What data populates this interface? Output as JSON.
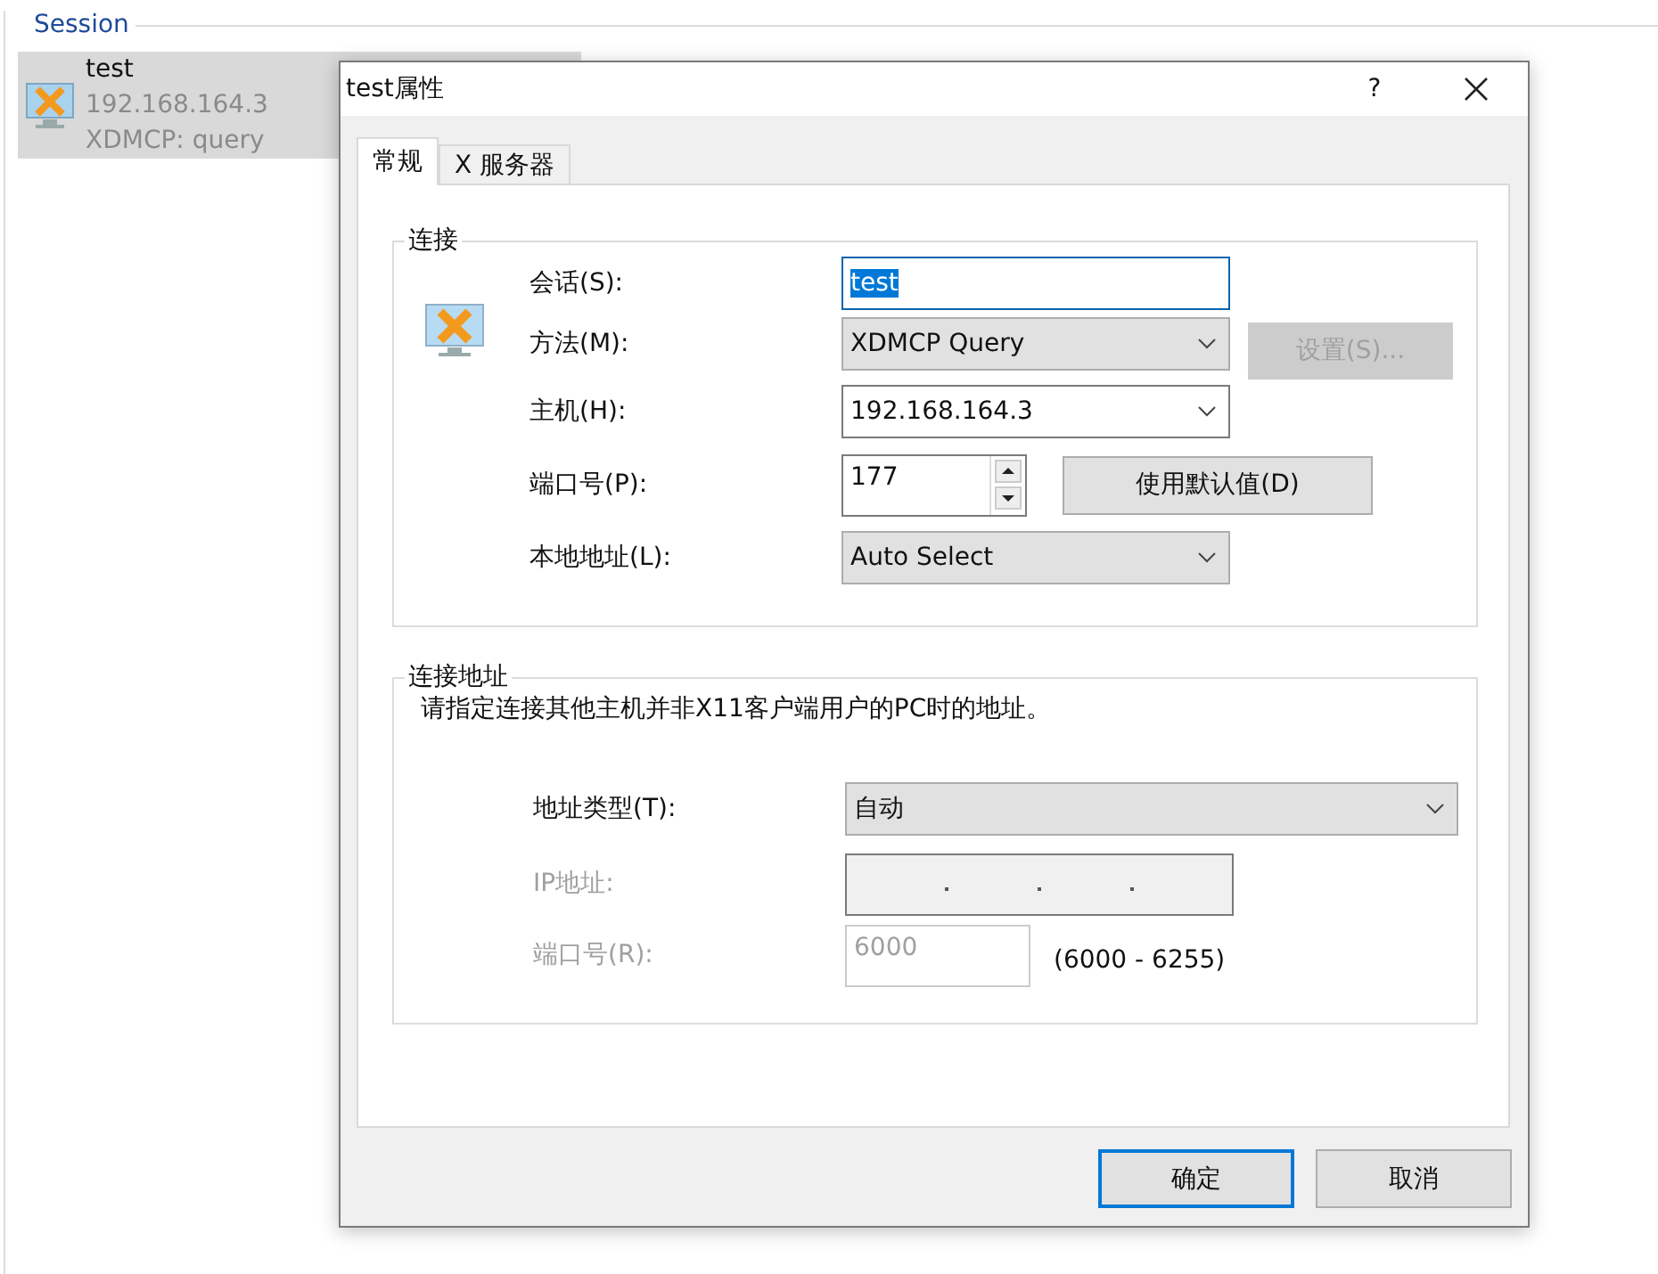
{
  "session_list": {
    "title": "Session",
    "items": [
      {
        "name": "test",
        "host": "192.168.164.3",
        "method": "XDMCP: query",
        "selected": true
      }
    ]
  },
  "dialog": {
    "title": "test属性",
    "help": "?",
    "tabs": [
      {
        "label": "常规",
        "selected": true
      },
      {
        "label": "X 服务器",
        "selected": false
      }
    ],
    "connection": {
      "title": "连接",
      "rows": [
        {
          "kind": "text",
          "label": "会话(S):",
          "value": "test",
          "text_selected": true
        },
        {
          "kind": "combo",
          "label": "方法(M):",
          "value": "XDMCP Query",
          "editable": false,
          "button": {
            "label": "设置(S)...",
            "disabled": true
          }
        },
        {
          "kind": "combo",
          "label": "主机(H):",
          "value": "192.168.164.3",
          "editable": true
        },
        {
          "kind": "spin",
          "label": "端口号(P):",
          "value": "177",
          "button": {
            "label": "使用默认值(D)",
            "disabled": false
          }
        },
        {
          "kind": "combo",
          "label": "本地地址(L):",
          "value": "Auto Select",
          "editable": false
        }
      ]
    },
    "address": {
      "title": "连接地址",
      "description": "请指定连接其他主机并非X11客户端用户的PC时的地址。",
      "rows": [
        {
          "kind": "wide-combo",
          "label": "地址类型(T):",
          "value": "自动",
          "editable": false,
          "disabled": false
        },
        {
          "kind": "ip",
          "label": "IP地址:",
          "disabled": true
        },
        {
          "kind": "port",
          "label": "端口号(R):",
          "value": "6000",
          "range": "(6000 - 6255)",
          "disabled": true
        }
      ]
    },
    "buttons": [
      {
        "label": "确定",
        "default": true
      },
      {
        "label": "取消",
        "default": false
      }
    ]
  }
}
